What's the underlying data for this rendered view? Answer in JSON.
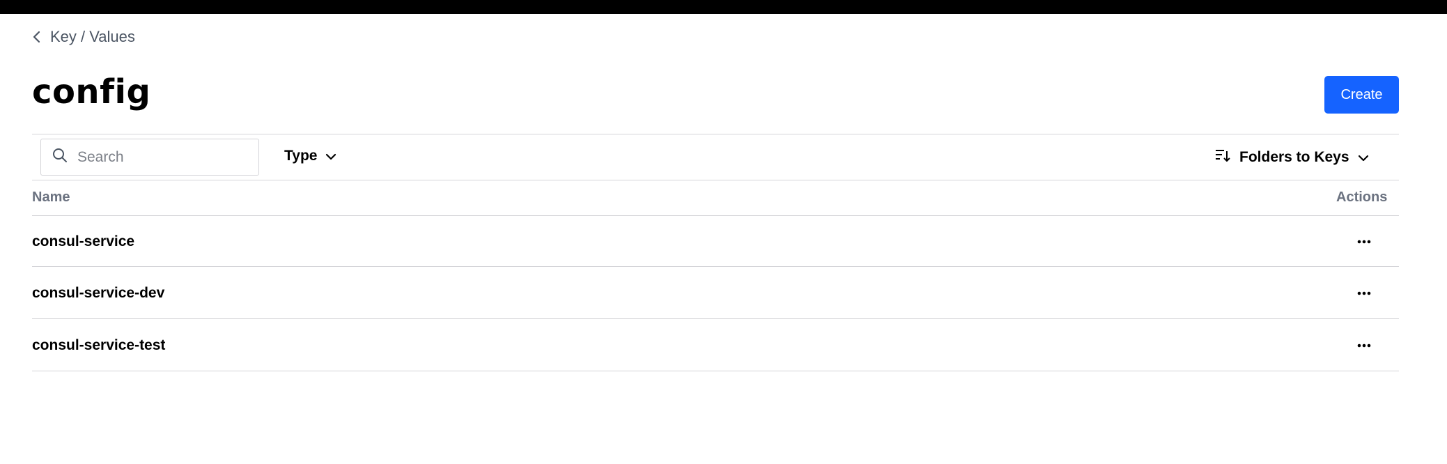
{
  "breadcrumb": {
    "label": "Key / Values"
  },
  "page": {
    "title": "config"
  },
  "toolbar": {
    "create_label": "Create",
    "search_placeholder": "Search",
    "type_filter_label": "Type",
    "sort_label": "Folders to Keys"
  },
  "table": {
    "columns": {
      "name": "Name",
      "actions": "Actions"
    },
    "rows": [
      {
        "name": "consul-service"
      },
      {
        "name": "consul-service-dev"
      },
      {
        "name": "consul-service-test"
      }
    ]
  },
  "colors": {
    "primary": "#1563ff",
    "muted_text": "#6b7280",
    "border": "#d4d4d8"
  }
}
